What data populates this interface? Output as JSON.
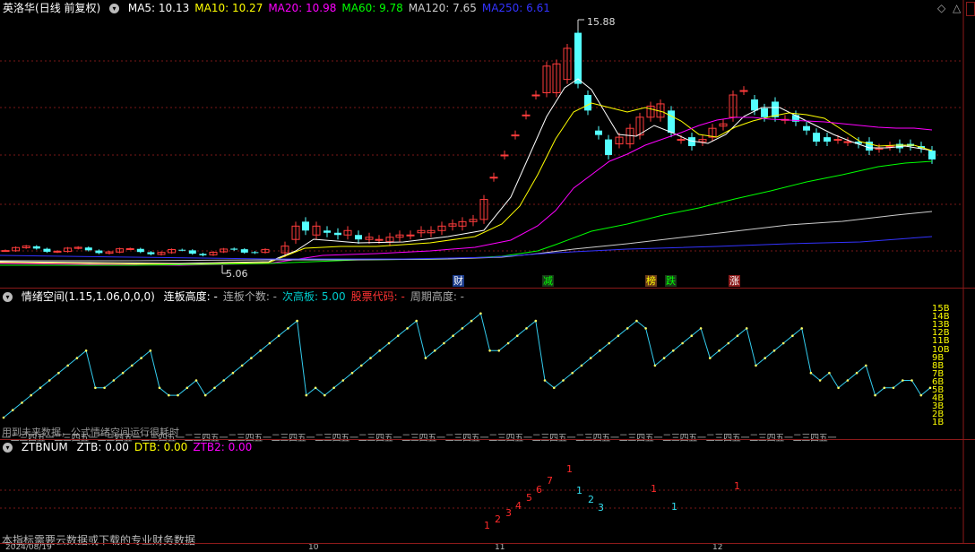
{
  "main_header": {
    "stock_name": "英洛华",
    "period": "(日线 前复权)",
    "ma": [
      {
        "label": "MA5: 10.13",
        "color": "#ffffff"
      },
      {
        "label": "MA10: 10.27",
        "color": "#ffff00"
      },
      {
        "label": "MA20: 10.98",
        "color": "#ff00ff"
      },
      {
        "label": "MA60: 9.78",
        "color": "#00ff00"
      },
      {
        "label": "MA120: 7.65",
        "color": "#cccccc"
      },
      {
        "label": "MA250: 6.61",
        "color": "#3333ff"
      }
    ]
  },
  "price_labels": {
    "high": "15.88",
    "low": "5.06"
  },
  "markers": [
    {
      "text": "财",
      "color": "#ffffff",
      "bg": "#1a3a8a"
    },
    {
      "text": "减",
      "color": "#00ff00",
      "bg": "#1a3a1a"
    },
    {
      "text": "榜",
      "color": "#ffff00",
      "bg": "#6b3a1a"
    },
    {
      "text": "跌",
      "color": "#00ff00",
      "bg": "#1a3a1a"
    },
    {
      "text": "涨",
      "color": "#ffffff",
      "bg": "#8b1a1a"
    }
  ],
  "panel2": {
    "name": "情绪空间(1.15,1.06,0,0,0)",
    "items": [
      {
        "label": "连板高度: -",
        "color": "#ffffff"
      },
      {
        "label": "连板个数: -",
        "color": "#aaaaaa"
      },
      {
        "label": "次高板: 5.00",
        "color": "#00cccc"
      },
      {
        "label": "股票代码: -",
        "color": "#ff3333"
      },
      {
        "label": "周期高度: -",
        "color": "#aaaaaa"
      }
    ],
    "scale": [
      "15B",
      "14B",
      "13B",
      "12B",
      "11B",
      "10B",
      "9B",
      "8B",
      "7B",
      "6B",
      "5B",
      "4B",
      "3B",
      "2B",
      "1B"
    ],
    "note": "用到未来数据，公式情绪空间运行很耗时",
    "cycle_text": "一二三四五一二三四五一二三四五一二三四五一二三四五一二三四五一二三四五一二三四五一二三四五一二三四五一二三四五一二三四五一二三四五一二三四五一二三四五一二三四五一二三四五一二三四五一二三四五一"
  },
  "panel3": {
    "name": "ZTBNUM",
    "items": [
      {
        "label": "ZTB: 0.00",
        "color": "#ffffff"
      },
      {
        "label": "DTB: 0.00",
        "color": "#ffff00"
      },
      {
        "label": "ZTB2: 0.00",
        "color": "#ff00ff"
      }
    ],
    "red_counts": [
      "1",
      "2",
      "3",
      "4",
      "5",
      "6",
      "7",
      "1",
      "1",
      "1"
    ],
    "cyan_counts": [
      "1",
      "2",
      "3",
      "1"
    ],
    "note": "本指标需要云数据或下载的专业财务数据"
  },
  "bottom_axis": {
    "date": "2024/08/19",
    "ticks": [
      "10",
      "11",
      "12"
    ]
  },
  "emotion_values": [
    1,
    2,
    3,
    4,
    5,
    6,
    7,
    8,
    9,
    10,
    5,
    5,
    6,
    7,
    8,
    9,
    10,
    5,
    4,
    4,
    5,
    6,
    4,
    5,
    6,
    7,
    8,
    9,
    10,
    11,
    12,
    13,
    14,
    4,
    5,
    4,
    5,
    6,
    7,
    8,
    9,
    10,
    11,
    12,
    13,
    14,
    9,
    10,
    11,
    12,
    13,
    14,
    15,
    10,
    10,
    11,
    12,
    13,
    14,
    6,
    5,
    6,
    7,
    8,
    9,
    10,
    11,
    12,
    13,
    14,
    13,
    8,
    9,
    10,
    11,
    12,
    13,
    9,
    10,
    11,
    12,
    13,
    8,
    9,
    10,
    11,
    12,
    13,
    7,
    6,
    7,
    5,
    6,
    7,
    8,
    4,
    5,
    5,
    6,
    6,
    4,
    5
  ]
}
